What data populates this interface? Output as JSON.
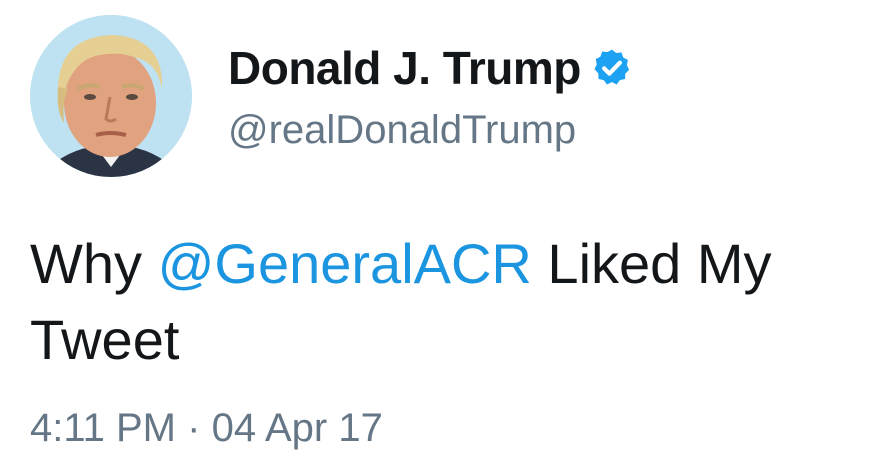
{
  "tweet": {
    "author": {
      "display_name": "Donald J. Trump",
      "handle": "@realDonaldTrump",
      "verified_icon": "verified-badge-icon",
      "avatar": "profile-photo"
    },
    "body": {
      "prefix": "Why ",
      "mention": "@GeneralACR",
      "suffix": " Liked My Tweet"
    },
    "meta": {
      "time": "4:11 PM",
      "separator": "·",
      "date": "04 Apr 17"
    }
  },
  "colors": {
    "text": "#14171a",
    "secondary": "#657786",
    "link": "#1b95e0",
    "verified": "#1da1f2"
  }
}
